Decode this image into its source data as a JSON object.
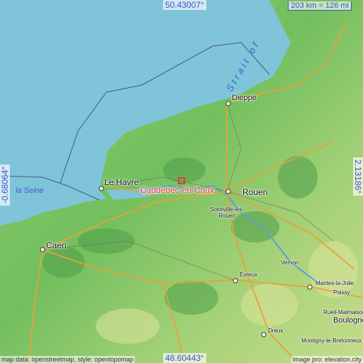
{
  "map": {
    "coords": {
      "top": "50.43007°",
      "bottom": "48.60443°",
      "left": "-0.68064°",
      "right": "2.13186°"
    },
    "scale_label": "203 km = 126 mi",
    "highlight": "Caudebec-en-Caux",
    "water_labels": {
      "seine": "la Seine",
      "strait": "Strait of"
    },
    "places": {
      "dieppe": "Dieppe",
      "le_havre": "Le Havre",
      "rouen": "Rouen",
      "sotteville": "Sotteville-lès-Rouen",
      "caen": "Caen",
      "evreux": "Évreux",
      "vernon": "Vernon",
      "mantes": "Mantes-la-Jolie",
      "poissy": "Poissy",
      "rueil": "Rueil-Malmaison",
      "boulogne": "Boulogne",
      "montigny": "Montigny-le-Bretonneux",
      "dreux": "Dreux"
    },
    "credit_left": "map data: openstreetmap, style: opentopomap",
    "credit_right": "image pro: elevation.city",
    "colors": {
      "sea": "#7fc4d9",
      "land_low": "#5fb85a",
      "land_mid": "#8ccb6e",
      "land_high": "#c4dc8a",
      "road": "#e8a13a",
      "highlight": "#e8383e"
    }
  }
}
